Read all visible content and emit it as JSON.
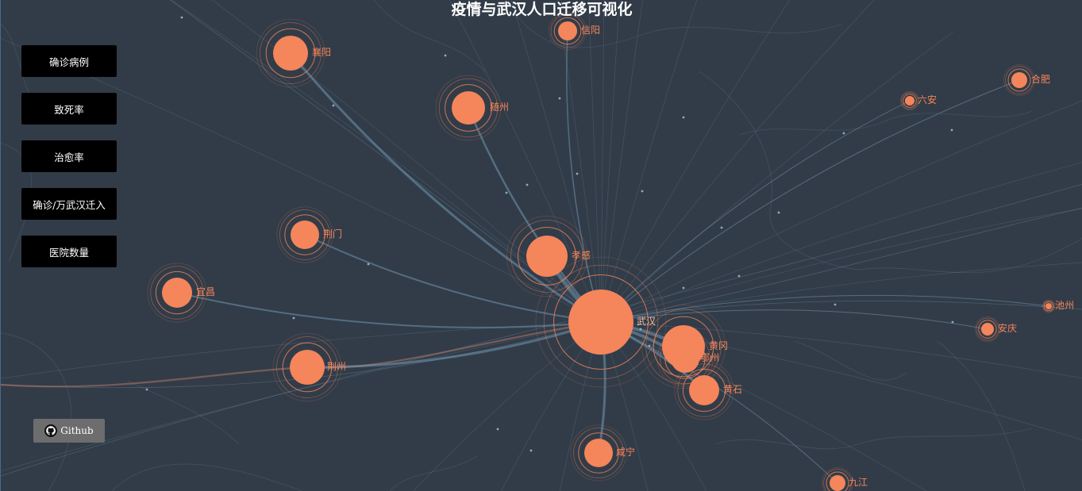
{
  "title": "疫情与武汉人口迁移可视化",
  "menu": {
    "buttons": [
      {
        "label": "确诊病例"
      },
      {
        "label": "致死率"
      },
      {
        "label": "治愈率"
      },
      {
        "label": "确诊/万武汉迁入"
      },
      {
        "label": "医院数量"
      }
    ]
  },
  "github": {
    "label": "Github",
    "icon": "github-icon"
  },
  "colors": {
    "background": "#323c48",
    "city_fill": "#f5855a",
    "label": "#f5855a",
    "ring": "#f5855a",
    "flow_line": "#7fa9c8",
    "border_line": "#46566a"
  },
  "hub": {
    "name": "武汉"
  },
  "cities": [
    {
      "name": "襄阳"
    },
    {
      "name": "信阳"
    },
    {
      "name": "随州"
    },
    {
      "name": "合肥"
    },
    {
      "name": "六安"
    },
    {
      "name": "荆门"
    },
    {
      "name": "孝感"
    },
    {
      "name": "宜昌"
    },
    {
      "name": "武汉"
    },
    {
      "name": "池州"
    },
    {
      "name": "安庆"
    },
    {
      "name": "黄冈"
    },
    {
      "name": "鄂州"
    },
    {
      "name": "荆州"
    },
    {
      "name": "黄石"
    },
    {
      "name": "咸宁"
    },
    {
      "name": "九江"
    }
  ]
}
